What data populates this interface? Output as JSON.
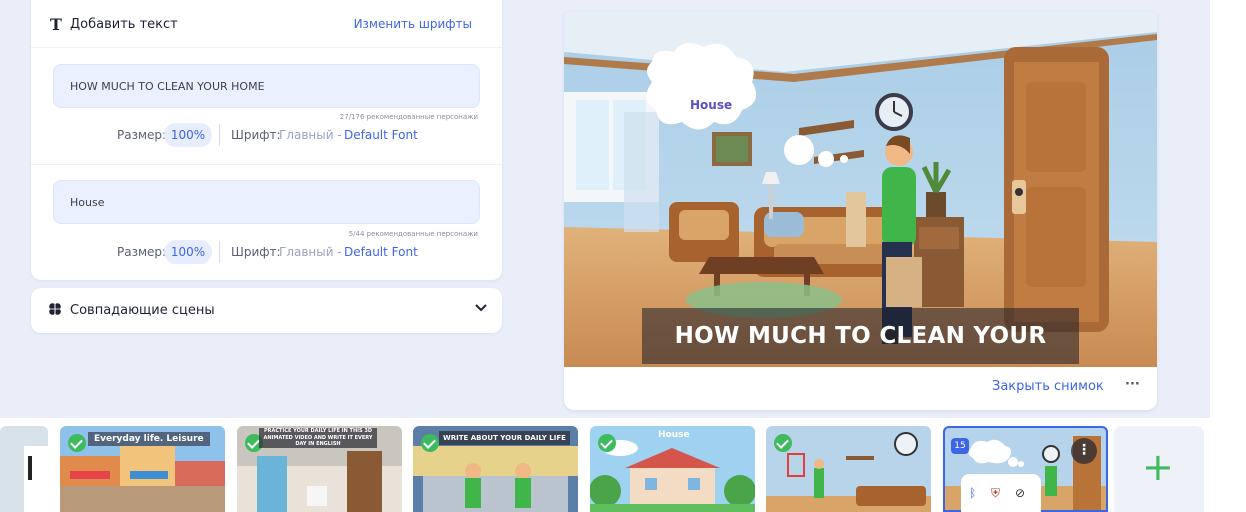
{
  "text_panel": {
    "title": "Добавить текст",
    "change_fonts": "Изменить шрифты",
    "fields": [
      {
        "value": "HOW MUCH TO CLEAN YOUR HOME",
        "counter": "27/176 рекомендованные персонажи",
        "size_label": "Размер:",
        "size_value": "100%",
        "font_label": "Шрифт:",
        "font_group": "Главный -",
        "font_name": "Default Font"
      },
      {
        "value": "House",
        "counter": "5/44 рекомендованные персонажи",
        "size_label": "Размер:",
        "size_value": "100%",
        "font_label": "Шрифт:",
        "font_group": "Главный -",
        "font_name": "Default Font"
      }
    ]
  },
  "matching_scenes": {
    "title": "Совпадающие сцены"
  },
  "preview": {
    "overlay_title": "HOW MUCH TO CLEAN YOUR HOME",
    "bubble_text": "House",
    "close_snapshot": "Закрыть снимок",
    "more": "···"
  },
  "thumbnails": [
    {
      "label": "Everyday life. Leisure"
    },
    {
      "label": "PRACTICE YOUR DAILY LIFE IN THIS 3D ANIMATED VIDEO AND WRITE IT EVERY DAY IN ENGLISH"
    },
    {
      "label": "WRITE ABOUT YOUR DAILY LIFE"
    },
    {
      "label": "House"
    },
    {
      "label": ""
    },
    {
      "badge": "15",
      "menu": "⋮"
    }
  ],
  "add_button": "+",
  "colors": {
    "accent": "#3d66e6",
    "success": "#3dbb5e",
    "workspace_bg": "#e9eef9"
  }
}
